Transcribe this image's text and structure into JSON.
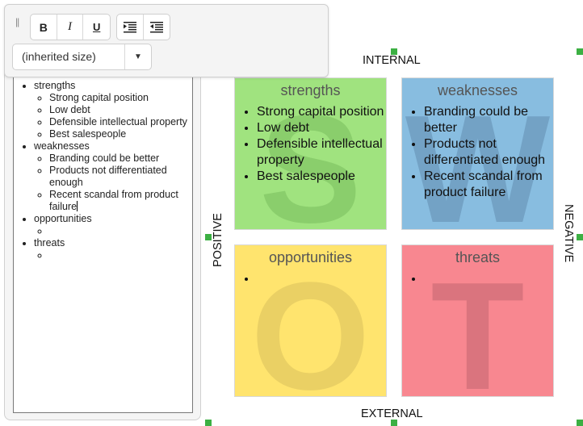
{
  "toolbar": {
    "grip": "||",
    "bold_label": "B",
    "italic_label": "I",
    "underline_label": "U",
    "indent_icon": "indent-icon",
    "outdent_icon": "outdent-icon",
    "font_size_value": "(inherited size)",
    "dropdown_arrow": "▼"
  },
  "editor": {
    "sections": [
      {
        "label": "strengths",
        "items": [
          "Strong capital position",
          "Low debt",
          "Defensible intellectual property",
          "Best salespeople"
        ]
      },
      {
        "label": "weaknesses",
        "items": [
          "Branding could be better",
          "Products not differentiated enough",
          "Recent scandal from product failure"
        ]
      },
      {
        "label": "opportunities",
        "items": [
          ""
        ]
      },
      {
        "label": "threats",
        "items": [
          ""
        ]
      }
    ]
  },
  "swot": {
    "axes": {
      "top": "INTERNAL",
      "bottom": "EXTERNAL",
      "left": "POSITIVE",
      "right": "NEGATIVE"
    },
    "quadrants": [
      {
        "title": "strengths",
        "letter": "S",
        "color": "#a0e37f",
        "items": [
          "Strong capital position",
          "Low debt",
          "Defensible intellectual property",
          "Best salespeople"
        ]
      },
      {
        "title": "weaknesses",
        "letter": "W",
        "color": "#88bde0",
        "items": [
          "Branding could be better",
          "Products not differentiated enough",
          "Recent scandal from product failure"
        ]
      },
      {
        "title": "opportunities",
        "letter": "O",
        "color": "#ffe46e",
        "items": [
          ""
        ]
      },
      {
        "title": "threats",
        "letter": "T",
        "color": "#f88790",
        "items": [
          ""
        ]
      }
    ],
    "selection_handle_color": "#3cb043"
  }
}
